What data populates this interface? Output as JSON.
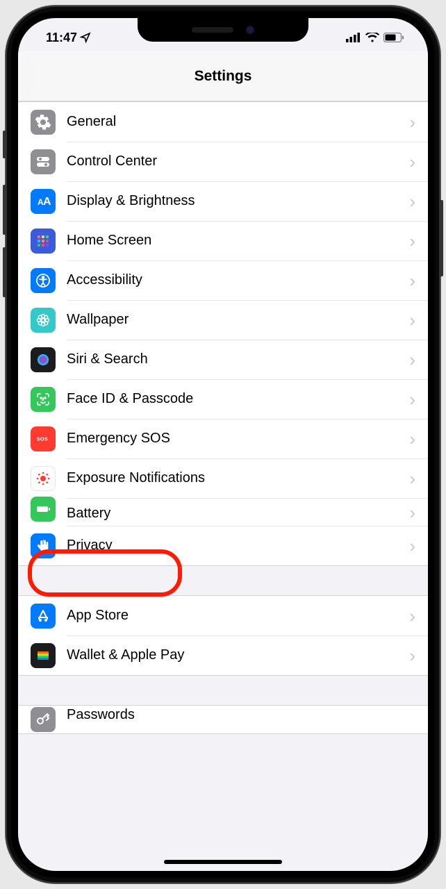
{
  "status": {
    "time": "11:47"
  },
  "header": {
    "title": "Settings"
  },
  "groups": [
    {
      "rows": [
        {
          "id": "general",
          "label": "General",
          "icon": "gear-icon",
          "bg": "bg-gray"
        },
        {
          "id": "control-center",
          "label": "Control Center",
          "icon": "switches-icon",
          "bg": "bg-gray"
        },
        {
          "id": "display",
          "label": "Display & Brightness",
          "icon": "aa-icon",
          "bg": "bg-blue"
        },
        {
          "id": "home-screen",
          "label": "Home Screen",
          "icon": "grid-icon",
          "bg": "bg-blue"
        },
        {
          "id": "accessibility",
          "label": "Accessibility",
          "icon": "accessibility-icon",
          "bg": "bg-blue"
        },
        {
          "id": "wallpaper",
          "label": "Wallpaper",
          "icon": "flower-icon",
          "bg": "bg-teal"
        },
        {
          "id": "siri",
          "label": "Siri & Search",
          "icon": "siri-icon",
          "bg": "bg-black"
        },
        {
          "id": "faceid",
          "label": "Face ID & Passcode",
          "icon": "face-icon",
          "bg": "bg-green"
        },
        {
          "id": "sos",
          "label": "Emergency SOS",
          "icon": "sos-icon",
          "bg": "bg-red"
        },
        {
          "id": "exposure",
          "label": "Exposure Notifications",
          "icon": "exposure-icon",
          "bg": "bg-white"
        },
        {
          "id": "battery",
          "label": "Battery",
          "icon": "battery-icon",
          "bg": "bg-green"
        },
        {
          "id": "privacy",
          "label": "Privacy",
          "icon": "hand-icon",
          "bg": "bg-blue"
        }
      ]
    },
    {
      "rows": [
        {
          "id": "appstore",
          "label": "App Store",
          "icon": "appstore-icon",
          "bg": "bg-blue"
        },
        {
          "id": "wallet",
          "label": "Wallet & Apple Pay",
          "icon": "wallet-icon",
          "bg": "bg-black"
        }
      ]
    },
    {
      "rows": [
        {
          "id": "passwords",
          "label": "Passwords",
          "icon": "key-icon",
          "bg": "bg-gray"
        }
      ]
    }
  ],
  "highlight_target": "privacy"
}
